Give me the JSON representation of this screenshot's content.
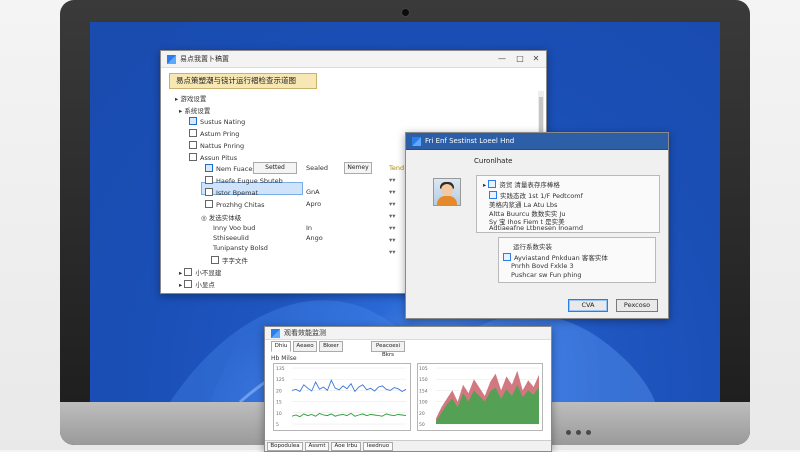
{
  "window_main": {
    "title": "易点我置卜稿置",
    "header": "易点策塑潮与铙计运行褶检查示道图",
    "tree": [
      {
        "label": "游戏设置"
      },
      {
        "label": "系统设置"
      },
      {
        "label": "Sustus Nating"
      },
      {
        "label": "Astum Pring"
      },
      {
        "label": "Nattus Pnring"
      },
      {
        "label": "Assun Pitus"
      }
    ],
    "selected_row": {
      "label": "Nem Fuaces",
      "button": "Setted",
      "col3": "Sealed",
      "col4": "Nemey",
      "col5": "Tend"
    },
    "rows": [
      {
        "label": "Haefe Eugue Sbuteb",
        "c1": "",
        "c2": ""
      },
      {
        "label": "Istor Bpemat",
        "c1": "GnA",
        "c2": ""
      },
      {
        "label": "Prozhhg Chitas",
        "c1": "Apro",
        "c2": ""
      },
      {
        "label": "发选实体级",
        "c1": "",
        "c2": ""
      },
      {
        "label": "Inny Voo bud",
        "c1": "In",
        "c2": ""
      },
      {
        "label": "Sthiseeulid",
        "c1": "Ango",
        "c2": ""
      },
      {
        "label": "Tunipansty Bolsd",
        "c1": "",
        "c2": ""
      },
      {
        "label": "字字文件",
        "c1": "",
        "c2": ""
      }
    ],
    "bottom_items": [
      {
        "label": "小不显建"
      },
      {
        "label": "小显点"
      }
    ]
  },
  "window_dialog": {
    "title": "Fri Enf Sestinst Loeel Hnd",
    "user_name": "Curonlhate",
    "group1": {
      "label": "资贸 清量表存序棒格",
      "lines": [
        "实践态改 1st 1/F Pedtcomf",
        "美格内浆通 La Atu Lbs",
        "Altta Buurcu 数数实实 Ju",
        "Sy 宝 Ihos Fiem t 是实美",
        "Adtiaeafne Ltbnesen Inoarnd"
      ]
    },
    "group2": {
      "label": "运行系数实装",
      "lines": [
        "Ayviastand Pnkduan 客客实体",
        "Pnrhh Bovd Fxkle 3",
        "Pushcar sw Fun phing"
      ]
    },
    "ok_label": "CVA",
    "cancel_label": "Pexcoso"
  },
  "window_chart": {
    "title": "观看效能监测",
    "tabs": [
      "Dhiu",
      "Aeaeo",
      "Bkeer",
      "Peacoesi Bkrs"
    ],
    "panel1_label": "Hb Milse",
    "left_y_ticks": [
      "135",
      "125",
      "20",
      "15",
      "10",
      "5"
    ],
    "right_y_ticks": [
      "105",
      "150",
      "154",
      "100",
      "20",
      "50"
    ],
    "status_items": [
      "Bopodulea",
      "Assmt",
      "Aoe Irbu",
      "Ieednuo"
    ],
    "left_series": {
      "name": "blue",
      "color": "#3a78d6",
      "values": [
        60,
        62,
        58,
        70,
        64,
        59,
        75,
        62,
        66,
        60,
        78,
        64,
        61,
        68,
        63,
        72,
        58,
        66,
        70,
        61,
        64,
        59,
        66,
        68,
        62,
        60,
        65,
        63,
        58,
        62
      ]
    },
    "left_series2": {
      "name": "green",
      "color": "#2e9e3a",
      "values": [
        14,
        16,
        13,
        18,
        15,
        17,
        14,
        19,
        16,
        15,
        18,
        14,
        16,
        17,
        15,
        19,
        14,
        16,
        18,
        15,
        17,
        16,
        15,
        14,
        18,
        16,
        15,
        17,
        16,
        15
      ]
    },
    "right_area_red": [
      10,
      30,
      45,
      60,
      40,
      70,
      55,
      80,
      65,
      50,
      75,
      90,
      60,
      85,
      70,
      95,
      60,
      78,
      66,
      88
    ],
    "right_area_green": [
      5,
      20,
      35,
      45,
      30,
      55,
      40,
      60,
      50,
      40,
      58,
      65,
      45,
      62,
      50,
      70,
      48,
      60,
      52,
      66
    ]
  },
  "colors": {
    "accent": "#2b7de9",
    "dialog_title": "#2c5fa6",
    "header_yellow": "#f6e7b4"
  }
}
